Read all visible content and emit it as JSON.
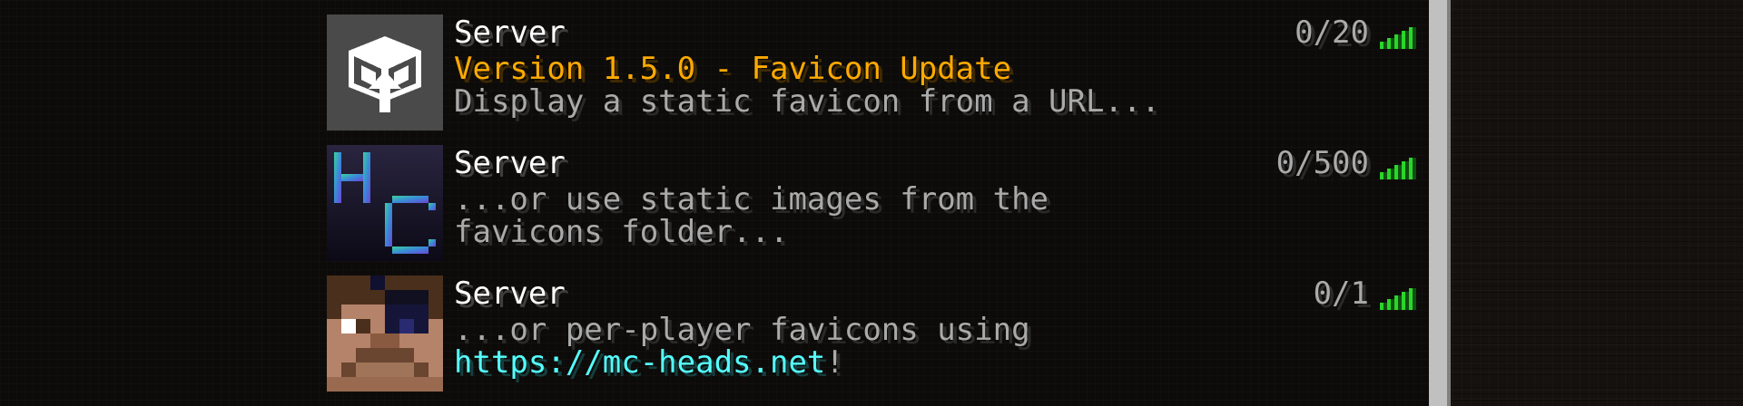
{
  "servers": [
    {
      "name": "Server",
      "players": "0/20",
      "motd_line1": "Version 1.5.0 - Favicon Update",
      "motd_line2": "Display a static favicon from a URL...",
      "favicon": "box-logo-icon",
      "ping": 5
    },
    {
      "name": "Server",
      "players": "0/500",
      "motd_line1": "...or use static images from the",
      "motd_line2": "favicons folder...",
      "favicon": "hc-logo-icon",
      "ping": 5
    },
    {
      "name": "Server",
      "players": "0/1",
      "motd_line1": "...or per-player favicons using",
      "motd_line2_link": "https://mc-heads.net",
      "motd_line2_suffix": "!",
      "favicon": "player-head-icon",
      "ping": 5
    }
  ],
  "colors": {
    "motd_gold": "#ffaa00",
    "motd_gray": "#aaaaaa",
    "link_aqua": "#55ffff",
    "ping_green": "#2bd52b"
  }
}
